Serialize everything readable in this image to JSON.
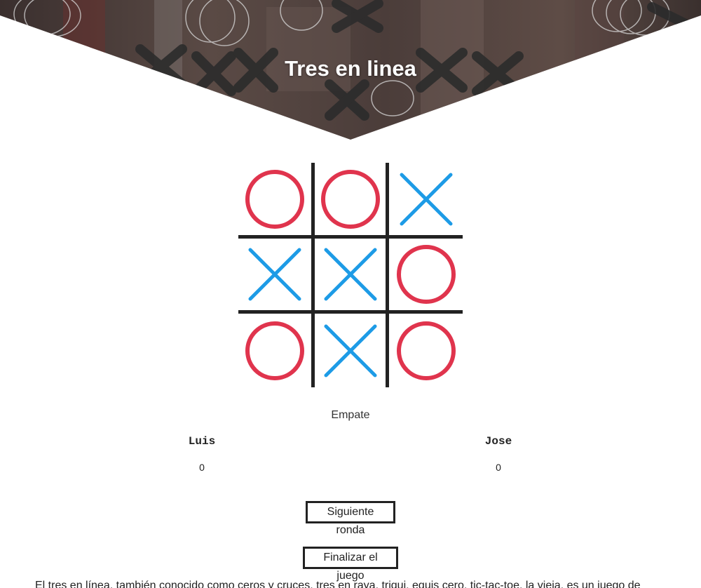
{
  "header": {
    "title": "Tres en linea"
  },
  "board": {
    "cells": [
      "O",
      "O",
      "X",
      "X",
      "X",
      "O",
      "O",
      "X",
      "O"
    ],
    "colors": {
      "O": "#e0344d",
      "X": "#1d9be6",
      "grid": "#222222"
    }
  },
  "game": {
    "status": "Empate",
    "players": [
      {
        "name": "Luis",
        "score": "0"
      },
      {
        "name": "Jose",
        "score": "0"
      }
    ]
  },
  "buttons": {
    "next_round": "Siguiente ronda",
    "end_game": "Finalizar el juego"
  },
  "description": "El tres en línea, también conocido como ceros y cruces, tres en raya, triqui, equis cero, tic-tac-toe, la vieja, es un juego de"
}
